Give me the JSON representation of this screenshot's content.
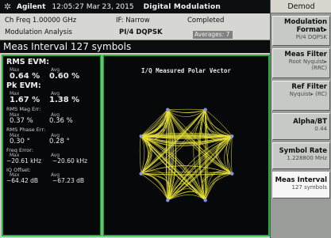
{
  "status_bar": {
    "brand": "Agilent",
    "datetime": "12:05:27  Mar 23, 2015",
    "mode": "Digital Modulation"
  },
  "info_bar": {
    "ch_freq": "Ch Freq 1.00000 GHz",
    "if": "IF: Narrow",
    "status": "Completed",
    "measurement": "Modulation Analysis",
    "format": "PI/4 DQPSK",
    "averages": "Averages: 7"
  },
  "measure_title": "Meas Interval 127 symbols",
  "metrics": {
    "rms_evm_label": "RMS EVM:",
    "pk_evm_label": "Pk EVM:",
    "max_label": "Max",
    "avg_label": "Avg",
    "rms_evm_max": "0.64 %",
    "rms_evm_avg": "0.60 %",
    "pk_evm_max": "1.67 %",
    "pk_evm_avg": "1.38 %",
    "rms_mag_err_label": "RMS Mag Err:",
    "rms_mag_err_max": "0.37 %",
    "rms_mag_err_avg": "0.36 %",
    "rms_phase_err_label": "RMS Phase Err:",
    "rms_phase_err_max": "0.30 °",
    "rms_phase_err_avg": "0.28 °",
    "freq_error_label": "Freq Error:",
    "freq_error_max": "−20.61 kHz",
    "freq_error_avg": "−20.60 kHz",
    "iq_offset_label": "IQ Offset:",
    "iq_offset_max": "−64.42 dB",
    "iq_offset_avg": "−67.23 dB"
  },
  "polar_panel": {
    "title": "I/Q Measured Polar Vector"
  },
  "softkeys": {
    "header": "Demod",
    "items": [
      {
        "label": "Modulation Format▸",
        "value": "Pi/4 DQPSK"
      },
      {
        "label": "Meas Filter",
        "value": "Root Nyquist▸ (RRC)"
      },
      {
        "label": "Ref Filter",
        "value": "Nyquist▸ (RC)"
      },
      {
        "label": "Alpha/BT",
        "value": "0.44"
      },
      {
        "label": "Symbol Rate",
        "value": "1.228800 MHz"
      },
      {
        "label": "Meas Interval",
        "value": "127 symbols"
      }
    ]
  },
  "colors": {
    "trace": "#e9e33a",
    "panel_border": "#27b13a",
    "screen_bg": "#070809"
  }
}
